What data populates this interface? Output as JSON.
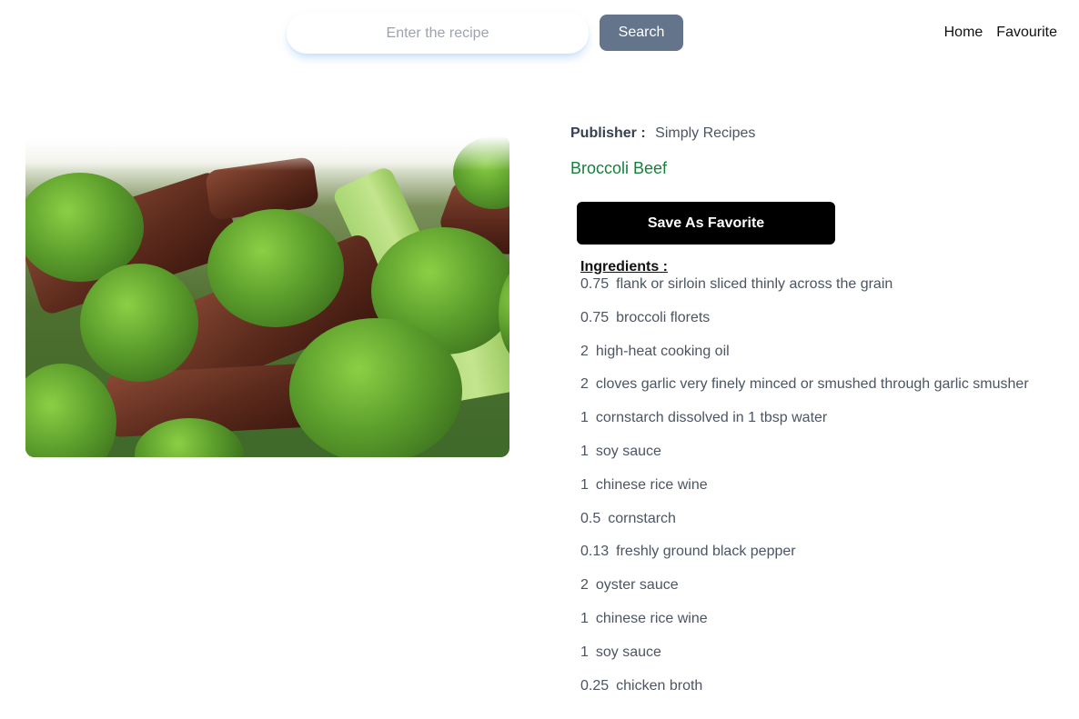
{
  "search": {
    "placeholder": "Enter the recipe",
    "button_label": "Search"
  },
  "nav": {
    "home": "Home",
    "favourite": "Favourite"
  },
  "recipe": {
    "publisher_label": "Publisher :",
    "publisher": "Simply Recipes",
    "title": "Broccoli Beef",
    "save_label": "Save As Favorite",
    "ingredients_heading": "Ingredients :",
    "ingredients": [
      {
        "qty": "0.75",
        "text": "flank or sirloin sliced thinly across the grain"
      },
      {
        "qty": "0.75",
        "text": "broccoli florets"
      },
      {
        "qty": "2",
        "text": "high-heat cooking oil"
      },
      {
        "qty": "2",
        "text": "cloves garlic very finely minced or smushed through garlic smusher"
      },
      {
        "qty": "1",
        "text": "cornstarch dissolved in 1 tbsp water"
      },
      {
        "qty": "1",
        "text": "soy sauce"
      },
      {
        "qty": "1",
        "text": "chinese rice wine"
      },
      {
        "qty": "0.5",
        "text": "cornstarch"
      },
      {
        "qty": "0.13",
        "text": "freshly ground black pepper"
      },
      {
        "qty": "2",
        "text": "oyster sauce"
      },
      {
        "qty": "1",
        "text": "chinese rice wine"
      },
      {
        "qty": "1",
        "text": "soy sauce"
      },
      {
        "qty": "0.25",
        "text": "chicken broth"
      }
    ]
  },
  "colors": {
    "search_button": "#64748b",
    "title_green": "#15803d",
    "favorite_button": "#000000"
  }
}
